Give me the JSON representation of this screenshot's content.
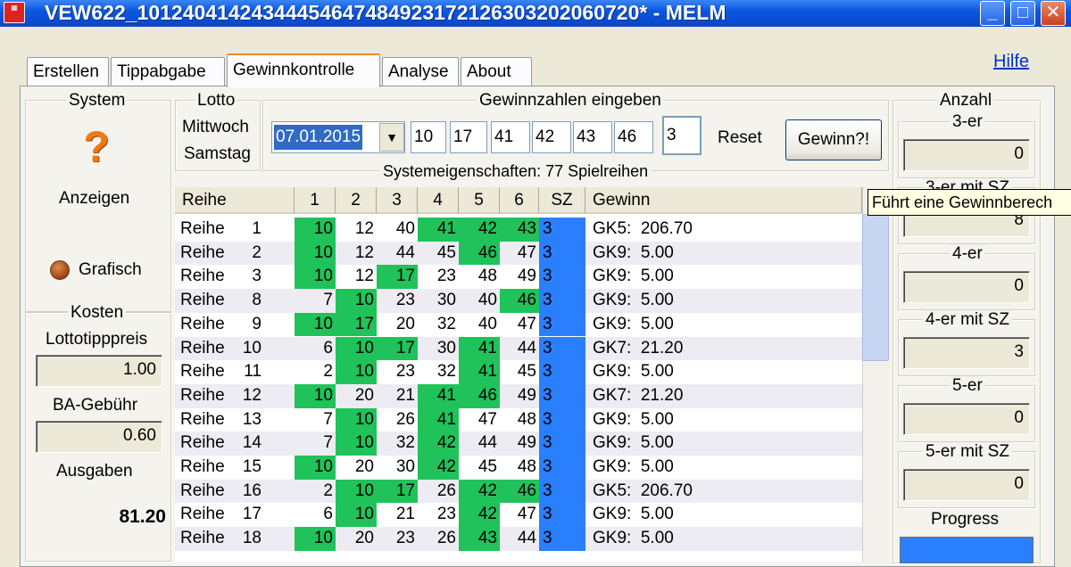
{
  "window": {
    "title": "VEW622_1012404142434445464748492317212630320206072​0* - MELM"
  },
  "tabs": [
    {
      "label": "Erstellen"
    },
    {
      "label": "Tippabgabe"
    },
    {
      "label": "Gewinnkontrolle"
    },
    {
      "label": "Analyse"
    },
    {
      "label": "About"
    }
  ],
  "help_label": "Hilfe",
  "system": {
    "legend": "System",
    "show_label": "Anzeigen",
    "grafisch_label": "Grafisch"
  },
  "kosten": {
    "legend": "Kosten",
    "tipp_label": "Lottotipppreis",
    "tipp_value": "1.00",
    "ba_label": "BA-Gebühr",
    "ba_value": "0.60",
    "ausgaben_label": "Ausgaben",
    "ausgaben_value": "81.20"
  },
  "lotto": {
    "legend": "Lotto",
    "mittwoch": "Mittwoch",
    "samstag": "Samstag"
  },
  "gewinnzahlen": {
    "legend": "Gewinnzahlen eingeben",
    "date": "07.01.2015",
    "numbers": [
      "10",
      "17",
      "41",
      "42",
      "43",
      "46"
    ],
    "sz": "3",
    "reset_label": "Reset",
    "gewinn_button": "Gewinn?!"
  },
  "system_props": "Systemeigenschaften: 77 Spielreihen",
  "table": {
    "headers": [
      "Reihe",
      "1",
      "2",
      "3",
      "4",
      "5",
      "6",
      "SZ",
      "Gewinn"
    ],
    "rows": [
      {
        "label": "Reihe",
        "n": "1",
        "v": [
          "10",
          "12",
          "40",
          "41",
          "42",
          "43"
        ],
        "sz": "3",
        "gewinn": "GK5:  206.70"
      },
      {
        "label": "Reihe",
        "n": "2",
        "v": [
          "10",
          "12",
          "44",
          "45",
          "46",
          "47"
        ],
        "sz": "3",
        "gewinn": "GK9:  5.00"
      },
      {
        "label": "Reihe",
        "n": "3",
        "v": [
          "10",
          "12",
          "17",
          "23",
          "48",
          "49"
        ],
        "sz": "3",
        "gewinn": "GK9:  5.00"
      },
      {
        "label": "Reihe",
        "n": "8",
        "v": [
          "7",
          "10",
          "23",
          "30",
          "40",
          "46"
        ],
        "sz": "3",
        "gewinn": "GK9:  5.00"
      },
      {
        "label": "Reihe",
        "n": "9",
        "v": [
          "10",
          "17",
          "20",
          "32",
          "40",
          "47"
        ],
        "sz": "3",
        "gewinn": "GK9:  5.00"
      },
      {
        "label": "Reihe",
        "n": "10",
        "v": [
          "6",
          "10",
          "17",
          "30",
          "41",
          "44"
        ],
        "sz": "3",
        "gewinn": "GK7:  21.20"
      },
      {
        "label": "Reihe",
        "n": "11",
        "v": [
          "2",
          "10",
          "23",
          "32",
          "41",
          "45"
        ],
        "sz": "3",
        "gewinn": "GK9:  5.00"
      },
      {
        "label": "Reihe",
        "n": "12",
        "v": [
          "10",
          "20",
          "21",
          "41",
          "46",
          "49"
        ],
        "sz": "3",
        "gewinn": "GK7:  21.20"
      },
      {
        "label": "Reihe",
        "n": "13",
        "v": [
          "7",
          "10",
          "26",
          "41",
          "47",
          "48"
        ],
        "sz": "3",
        "gewinn": "GK9:  5.00"
      },
      {
        "label": "Reihe",
        "n": "14",
        "v": [
          "7",
          "10",
          "32",
          "42",
          "44",
          "49"
        ],
        "sz": "3",
        "gewinn": "GK9:  5.00"
      },
      {
        "label": "Reihe",
        "n": "15",
        "v": [
          "10",
          "20",
          "30",
          "42",
          "45",
          "48"
        ],
        "sz": "3",
        "gewinn": "GK9:  5.00"
      },
      {
        "label": "Reihe",
        "n": "16",
        "v": [
          "2",
          "10",
          "17",
          "26",
          "42",
          "46"
        ],
        "sz": "3",
        "gewinn": "GK5:  206.70"
      },
      {
        "label": "Reihe",
        "n": "17",
        "v": [
          "6",
          "10",
          "21",
          "23",
          "42",
          "47"
        ],
        "sz": "3",
        "gewinn": "GK9:  5.00"
      },
      {
        "label": "Reihe",
        "n": "18",
        "v": [
          "10",
          "20",
          "23",
          "26",
          "43",
          "44"
        ],
        "sz": "3",
        "gewinn": "GK9:  5.00"
      }
    ]
  },
  "tooltip": "Führt eine Gewinnberech",
  "anzahl": {
    "legend": "Anzahl",
    "items": [
      {
        "label": "3-er",
        "value": "0"
      },
      {
        "label": "3-er mit SZ",
        "value": "8"
      },
      {
        "label": "4-er",
        "value": "0"
      },
      {
        "label": "4-er mit SZ",
        "value": "3"
      },
      {
        "label": "5-er",
        "value": "0"
      },
      {
        "label": "5-er mit SZ",
        "value": "0"
      }
    ],
    "progress_label": "Progress"
  },
  "colors": {
    "hit": "#1fc35a",
    "sz": "#2a7fff"
  }
}
